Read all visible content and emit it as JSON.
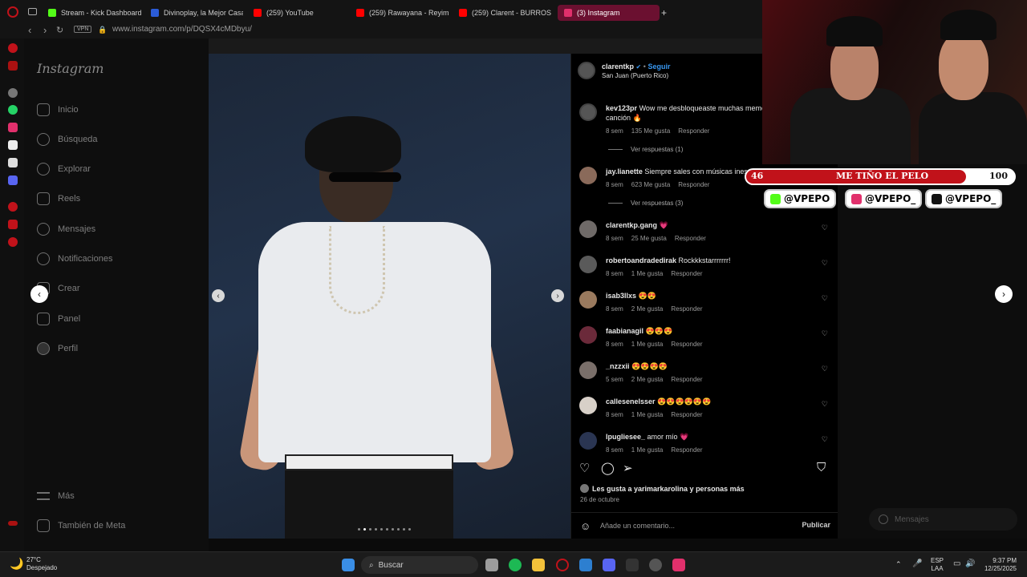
{
  "browser": {
    "tabs": [
      {
        "label": "Stream - Kick Dashboard",
        "color": "#53fc18"
      },
      {
        "label": "Divinoplay, la Mejor Casa",
        "color": "#2b5cd8"
      },
      {
        "label": "(259) YouTube",
        "color": "#ff0000"
      },
      {
        "label": "(259) Rawayana - Reyim",
        "color": "#ff0000"
      },
      {
        "label": "(259) Clarent - BURROS",
        "color": "#ff0000"
      },
      {
        "label": "(3) Instagram",
        "color": "#e1306c"
      }
    ],
    "new_tab": "+",
    "vpn": "VPN",
    "url": "www.instagram.com/p/DQSX4cMDbyu/"
  },
  "sidebar": {
    "logo": "Instagram",
    "items": [
      {
        "label": "Inicio",
        "icon": "home-icon"
      },
      {
        "label": "Búsqueda",
        "icon": "search-icon"
      },
      {
        "label": "Explorar",
        "icon": "compass-icon"
      },
      {
        "label": "Reels",
        "icon": "reels-icon"
      },
      {
        "label": "Mensajes",
        "icon": "messenger-icon"
      },
      {
        "label": "Notificaciones",
        "icon": "heart-icon"
      },
      {
        "label": "Crear",
        "icon": "plus-icon"
      },
      {
        "label": "Panel",
        "icon": "chart-icon"
      },
      {
        "label": "Perfil",
        "icon": "profile-icon"
      }
    ],
    "more": "Más",
    "meta": "También de Meta"
  },
  "post": {
    "author": "clarentkp",
    "verified": "✔",
    "separator": "•",
    "follow": "Seguir",
    "location": "San Juan (Puerto Rico)",
    "comments": [
      {
        "user": "kev123pr",
        "text": "Wow me desbloqueaste muchas memorias con esta canción 🔥",
        "age": "8 sem",
        "likes": "135 Me gusta",
        "reply": "Responder",
        "replies": "Ver respuestas (1)"
      },
      {
        "user": "jay.lianette",
        "text": "Siempre sales con músicas inesperadas",
        "age": "8 sem",
        "likes": "623 Me gusta",
        "reply": "Responder",
        "replies": "Ver respuestas (3)"
      },
      {
        "user": "clarentkp.gang",
        "text": "💗",
        "age": "8 sem",
        "likes": "25 Me gusta",
        "reply": "Responder"
      },
      {
        "user": "robertoandradedirak",
        "text": "Rockkkstarrrrrrr!",
        "age": "8 sem",
        "likes": "1 Me gusta",
        "reply": "Responder"
      },
      {
        "user": "isab3llxs",
        "text": "😍😍",
        "age": "8 sem",
        "likes": "2 Me gusta",
        "reply": "Responder"
      },
      {
        "user": "faabianagil",
        "text": "😍😍😍",
        "age": "8 sem",
        "likes": "1 Me gusta",
        "reply": "Responder"
      },
      {
        "user": "_nzzxii",
        "text": "😍😍😍😍",
        "age": "5 sem",
        "likes": "2 Me gusta",
        "reply": "Responder"
      },
      {
        "user": "callesenelsser",
        "text": "😍😍😍😍😍😍",
        "age": "8 sem",
        "likes": "1 Me gusta",
        "reply": "Responder"
      },
      {
        "user": "lpugliesee_",
        "text": "amor mío 💗",
        "age": "8 sem",
        "likes": "1 Me gusta",
        "reply": "Responder"
      }
    ],
    "liked_by": "Les gusta a yarimarkarolina y personas más",
    "date": "26 de octubre",
    "comment_placeholder": "Añade un comentario...",
    "publish": "Publicar"
  },
  "floating_messages": "Mensajes",
  "stream_overlay": {
    "goal_current": "46",
    "goal_label": "ME TIÑO EL PELO",
    "goal_target": "100",
    "goal_fraction": 0.46,
    "socials": [
      {
        "handle": "@VPEPO",
        "icon": "kick-icon",
        "color": "#53fc18"
      },
      {
        "handle": "@VPEPO_",
        "icon": "instagram-icon",
        "color": "#e1306c"
      },
      {
        "handle": "@VPEPO_",
        "icon": "tiktok-icon",
        "color": "#111111"
      }
    ]
  },
  "taskbar": {
    "weather_temp": "27°C",
    "weather_desc": "Despejado",
    "search": "Buscar",
    "lang": "ESP",
    "lang2": "LAA",
    "time": "9:37 PM",
    "date": "12/25/2025"
  }
}
